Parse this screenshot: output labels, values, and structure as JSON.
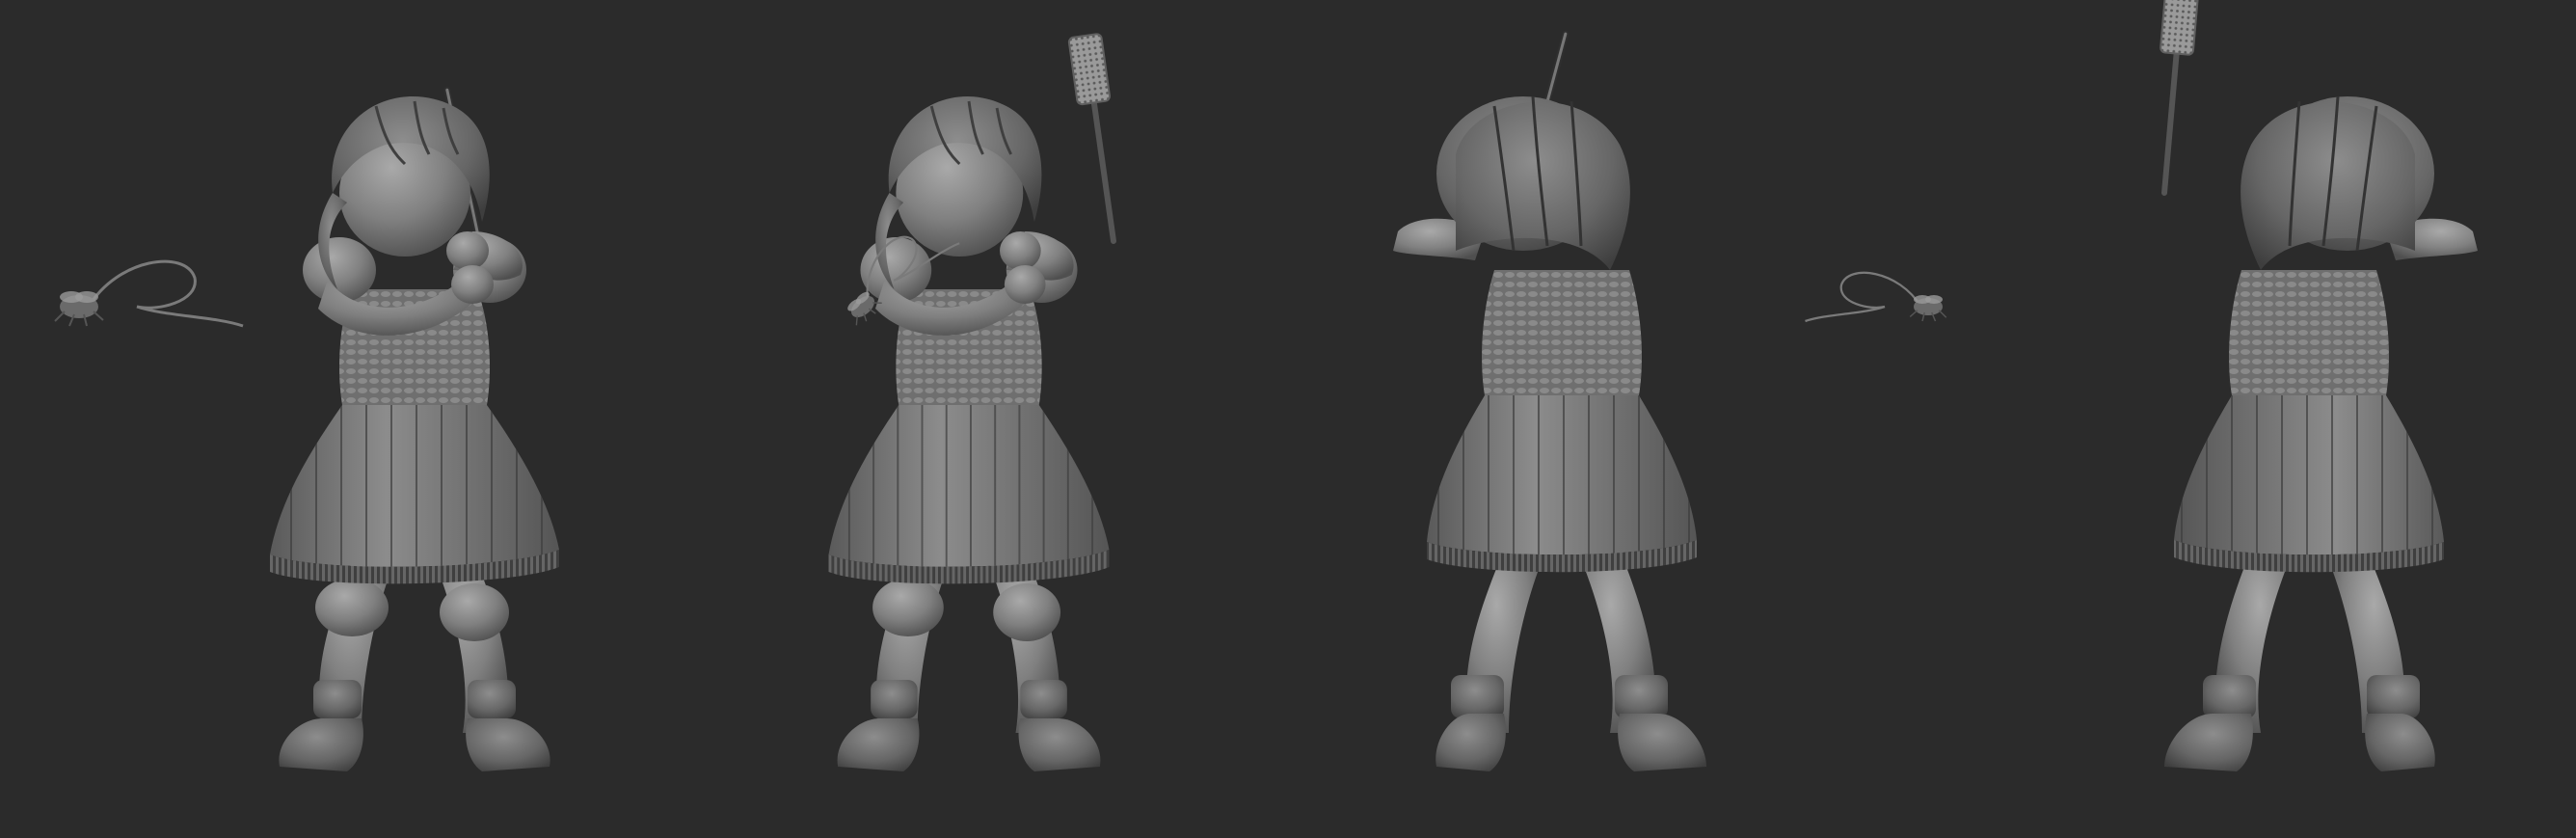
{
  "scene": {
    "background_color": "#2b2b2b",
    "clay_color": "#8a8a8a",
    "shadow_color": "#4a4a4a",
    "highlight_color": "#b5b5b5"
  },
  "figures": [
    {
      "view": "front",
      "holds": "fly-swatter",
      "prop": "fly"
    },
    {
      "view": "three-quarter-front",
      "holds": "fly-swatter",
      "prop": "fly"
    },
    {
      "view": "back",
      "holds": "fly-swatter",
      "prop": "fly"
    },
    {
      "view": "three-quarter-back",
      "holds": "fly-swatter",
      "prop": "none"
    }
  ]
}
